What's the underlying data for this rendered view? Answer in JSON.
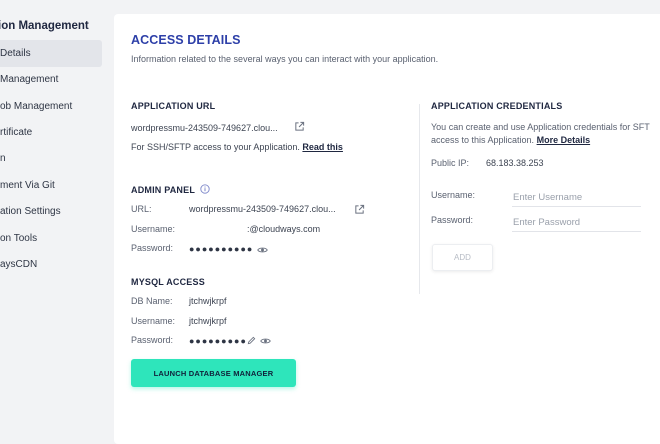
{
  "sidebar": {
    "title": "ion Management",
    "items": [
      {
        "label": "Details",
        "active": true
      },
      {
        "label": "Management"
      },
      {
        "label": "ob Management"
      },
      {
        "label": "rtificate"
      },
      {
        "label": "n"
      },
      {
        "label": "ment Via Git"
      },
      {
        "label": "ation Settings"
      },
      {
        "label": "on Tools"
      },
      {
        "label": "aysCDN"
      }
    ]
  },
  "main": {
    "title": "ACCESS DETAILS",
    "subtitle": "Information related to the several ways you can interact with your application.",
    "app_url": {
      "heading": "APPLICATION URL",
      "url": "wordpressmu-243509-749627.clou...",
      "ssh_text": "For SSH/SFTP access to your Application.",
      "read_this": "Read this"
    },
    "admin_panel": {
      "heading": "ADMIN PANEL",
      "url_label": "URL:",
      "url_value": "wordpressmu-243509-749627.clou...",
      "username_label": "Username:",
      "username_value": ":@cloudways.com",
      "password_label": "Password:",
      "password_value": "●●●●●●●●●●"
    },
    "mysql": {
      "heading": "MYSQL ACCESS",
      "db_label": "DB Name:",
      "db_value": "jtchwjkrpf",
      "username_label": "Username:",
      "username_value": "jtchwjkrpf",
      "password_label": "Password:",
      "password_value": "●●●●●●●●●",
      "launch_button": "LAUNCH DATABASE MANAGER"
    },
    "credentials": {
      "heading": "APPLICATION CREDENTIALS",
      "desc_line1": "You can create and use Application credentials for SFT",
      "desc_line2": "access to this Application.",
      "more_details": "More Details",
      "public_ip_label": "Public IP:",
      "public_ip_value": "68.183.38.253",
      "username_label": "Username:",
      "username_placeholder": "Enter Username",
      "password_label": "Password:",
      "password_placeholder": "Enter Password",
      "add_button": "ADD"
    }
  },
  "colors": {
    "accent_title": "#2d3fa8",
    "launch_button": "#2ee5bb",
    "background": "#f2f3f5"
  },
  "icons": [
    "external-link-icon",
    "info-icon",
    "eye-icon",
    "pencil-icon"
  ]
}
